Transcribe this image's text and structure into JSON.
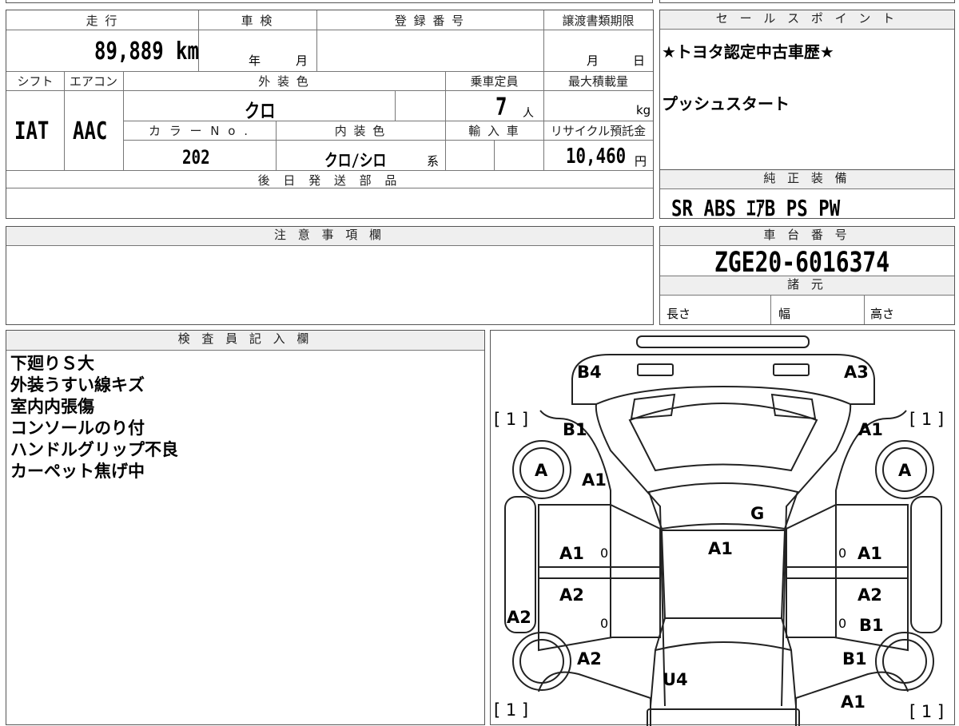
{
  "vehicle": {
    "mileage_label": "走 行",
    "mileage_value": "89,889",
    "mileage_unit": "km",
    "inspection_label": "車 検",
    "inspection_year": "年",
    "inspection_month": "月",
    "registration_label": "登 録 番 号",
    "transfer_label": "譲渡書類期限",
    "transfer_month": "月",
    "transfer_day": "日",
    "shift_label": "シフト",
    "ac_label": "エアコン",
    "shift_value": "IAT",
    "ac_value": "AAC",
    "exterior_color_label": "外 装 色",
    "exterior_color_value": "クロ",
    "capacity_label": "乗車定員",
    "capacity_value": "7",
    "capacity_unit": "人",
    "max_load_label": "最大積載量",
    "max_load_unit": "kg",
    "color_no_label": "カ ラ ー N o .",
    "color_no_value": "202",
    "interior_color_label": "内 装 色",
    "interior_color_value": "クロ/シロ",
    "interior_color_suffix": "系",
    "import_label": "輸 入 車",
    "recycle_label": "リサイクル預託金",
    "recycle_value": "10,460",
    "recycle_unit": "円",
    "later_parts_label": "後 日 発 送 部 品"
  },
  "sales_points": {
    "label": "セ ー ル ス ポ イ ン ト",
    "line1": "★トヨタ認定中古車歴★",
    "line2": "プッシュスタート"
  },
  "equipment": {
    "label": "純 正 装 備",
    "value": "SR ABS ｴｱB PS PW"
  },
  "notes": {
    "label": "注 意 事 項 欄"
  },
  "chassis": {
    "label": "車 台 番 号",
    "value": "ZGE20-6016374",
    "specs_label": "諸 元",
    "length_label": "長さ",
    "width_label": "幅",
    "height_label": "高さ"
  },
  "inspector": {
    "label": "検 査 員 記 入 欄",
    "lines": [
      "下廻りＳ大",
      "外装うすい線キズ",
      "室内内張傷",
      "コンソールのり付",
      "ハンドルグリップ不良",
      "カーペット焦げ中"
    ]
  },
  "diagram": {
    "marks": {
      "b4": "B4",
      "a3": "A3",
      "tire_fl": "[ 1 ]",
      "tire_fr": "[ 1 ]",
      "tire_rl": "[ 1 ]",
      "tire_rr": "[ 1 ]",
      "b1_fender_l": "B1",
      "a1_fender_r": "A1",
      "wheel_l": "A",
      "wheel_r": "A",
      "a1_pillar_l": "A1",
      "g_windshield": "G",
      "a1_roof": "A1",
      "a1_door_fl": "A1",
      "zero_fl": "0",
      "zero_fr": "0",
      "a1_door_fr": "A1",
      "a2_door_rl": "A2",
      "a2_door_rr": "A2",
      "zero_rl": "0",
      "zero_rr": "0",
      "b1_door_rr": "B1",
      "a2_sill_l": "A2",
      "a2_qtr_l": "A2",
      "b1_qtr_r": "B1",
      "u4_rear": "U4",
      "a1_rear_r": "A1"
    }
  }
}
